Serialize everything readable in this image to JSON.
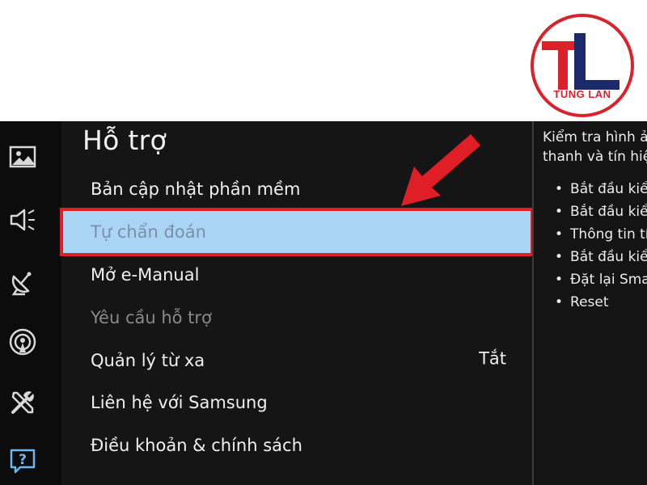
{
  "logo": {
    "letters": "TL",
    "text": "TUNG LAN"
  },
  "sidebar": {
    "icons": [
      "picture-icon",
      "sound-icon",
      "broadcast-icon",
      "network-icon",
      "tools-icon",
      "support-icon"
    ]
  },
  "menu": {
    "title": "Hỗ trợ",
    "items": [
      {
        "label": "Bản cập nhật phần mềm",
        "value": ""
      },
      {
        "label": "Tự chẩn đoán",
        "value": ""
      },
      {
        "label": "Mở e-Manual",
        "value": ""
      },
      {
        "label": "Yêu cầu hỗ trợ",
        "value": ""
      },
      {
        "label": "Quản lý từ xa",
        "value": "Tắt"
      },
      {
        "label": "Liên hệ với Samsung",
        "value": ""
      },
      {
        "label": "Điều khoản & chính sách",
        "value": ""
      }
    ],
    "selected_index": 1,
    "disabled_index": 3
  },
  "description": {
    "line1": "Kiểm tra hình ả",
    "line2": "thanh và tín hiệ",
    "bullets": [
      "Bắt đầu kiểm",
      "Bắt đầu kiểm",
      "Thông tin tín",
      "Bắt đầu kiểm",
      "Đặt lại Smar",
      "Reset"
    ]
  },
  "colors": {
    "highlight_bg": "#a9d4f3",
    "highlight_border": "#e01e26",
    "arrow": "#e01e26",
    "logo_red": "#d9222a",
    "logo_navy": "#1c2a6b"
  }
}
